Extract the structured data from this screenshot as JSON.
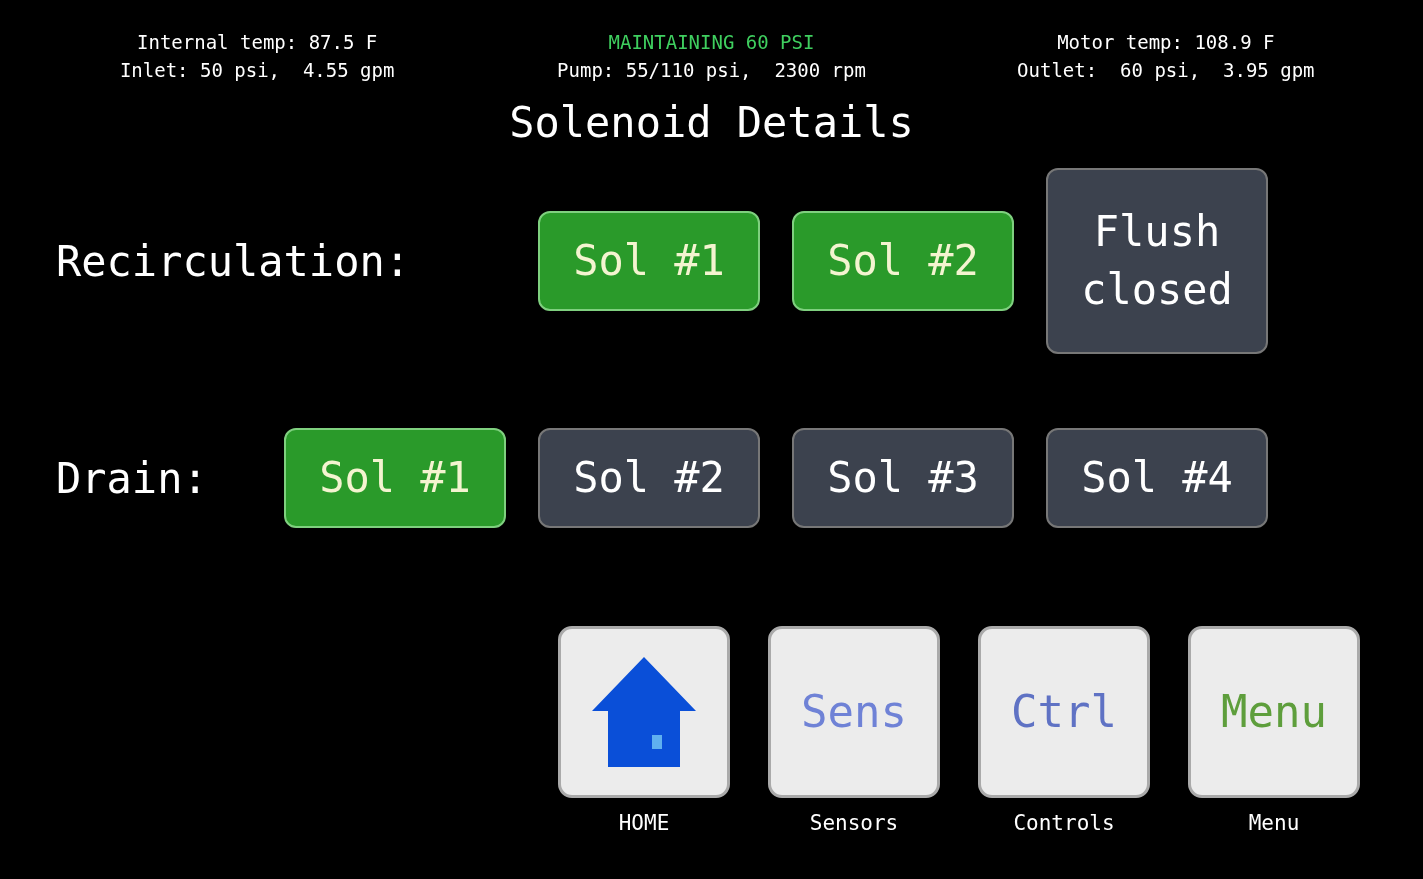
{
  "header": {
    "left": [
      "Internal temp: 87.5 F",
      "Inlet: 50 psi,  4.55 gpm"
    ],
    "status": "MAINTAINING 60 PSI",
    "center": "Pump: 55/110 psi,  2300 rpm",
    "right": [
      "Motor temp: 108.9 F",
      "Outlet:  60 psi,  3.95 gpm"
    ]
  },
  "title": "Solenoid Details",
  "groups": [
    {
      "label": "Recirculation:",
      "solenoids": [
        {
          "text": "Sol #1",
          "on": true
        },
        {
          "text": "Sol #2",
          "on": true
        },
        {
          "text": "Flush\nclosed",
          "on": false
        }
      ]
    },
    {
      "label": "Drain:",
      "solenoids": [
        {
          "text": "Sol #1",
          "on": true
        },
        {
          "text": "Sol #2",
          "on": false
        },
        {
          "text": "Sol #3",
          "on": false
        },
        {
          "text": "Sol #4",
          "on": false
        }
      ]
    }
  ],
  "nav": [
    {
      "kind": "icon",
      "caption": "HOME"
    },
    {
      "kind": "text",
      "text": "Sens",
      "color": "#6f82d6",
      "caption": "Sensors"
    },
    {
      "kind": "text",
      "text": "Ctrl",
      "color": "#5f72c4",
      "caption": "Controls"
    },
    {
      "kind": "text",
      "text": "Menu",
      "color": "#5e9e3c",
      "caption": "Menu"
    }
  ]
}
